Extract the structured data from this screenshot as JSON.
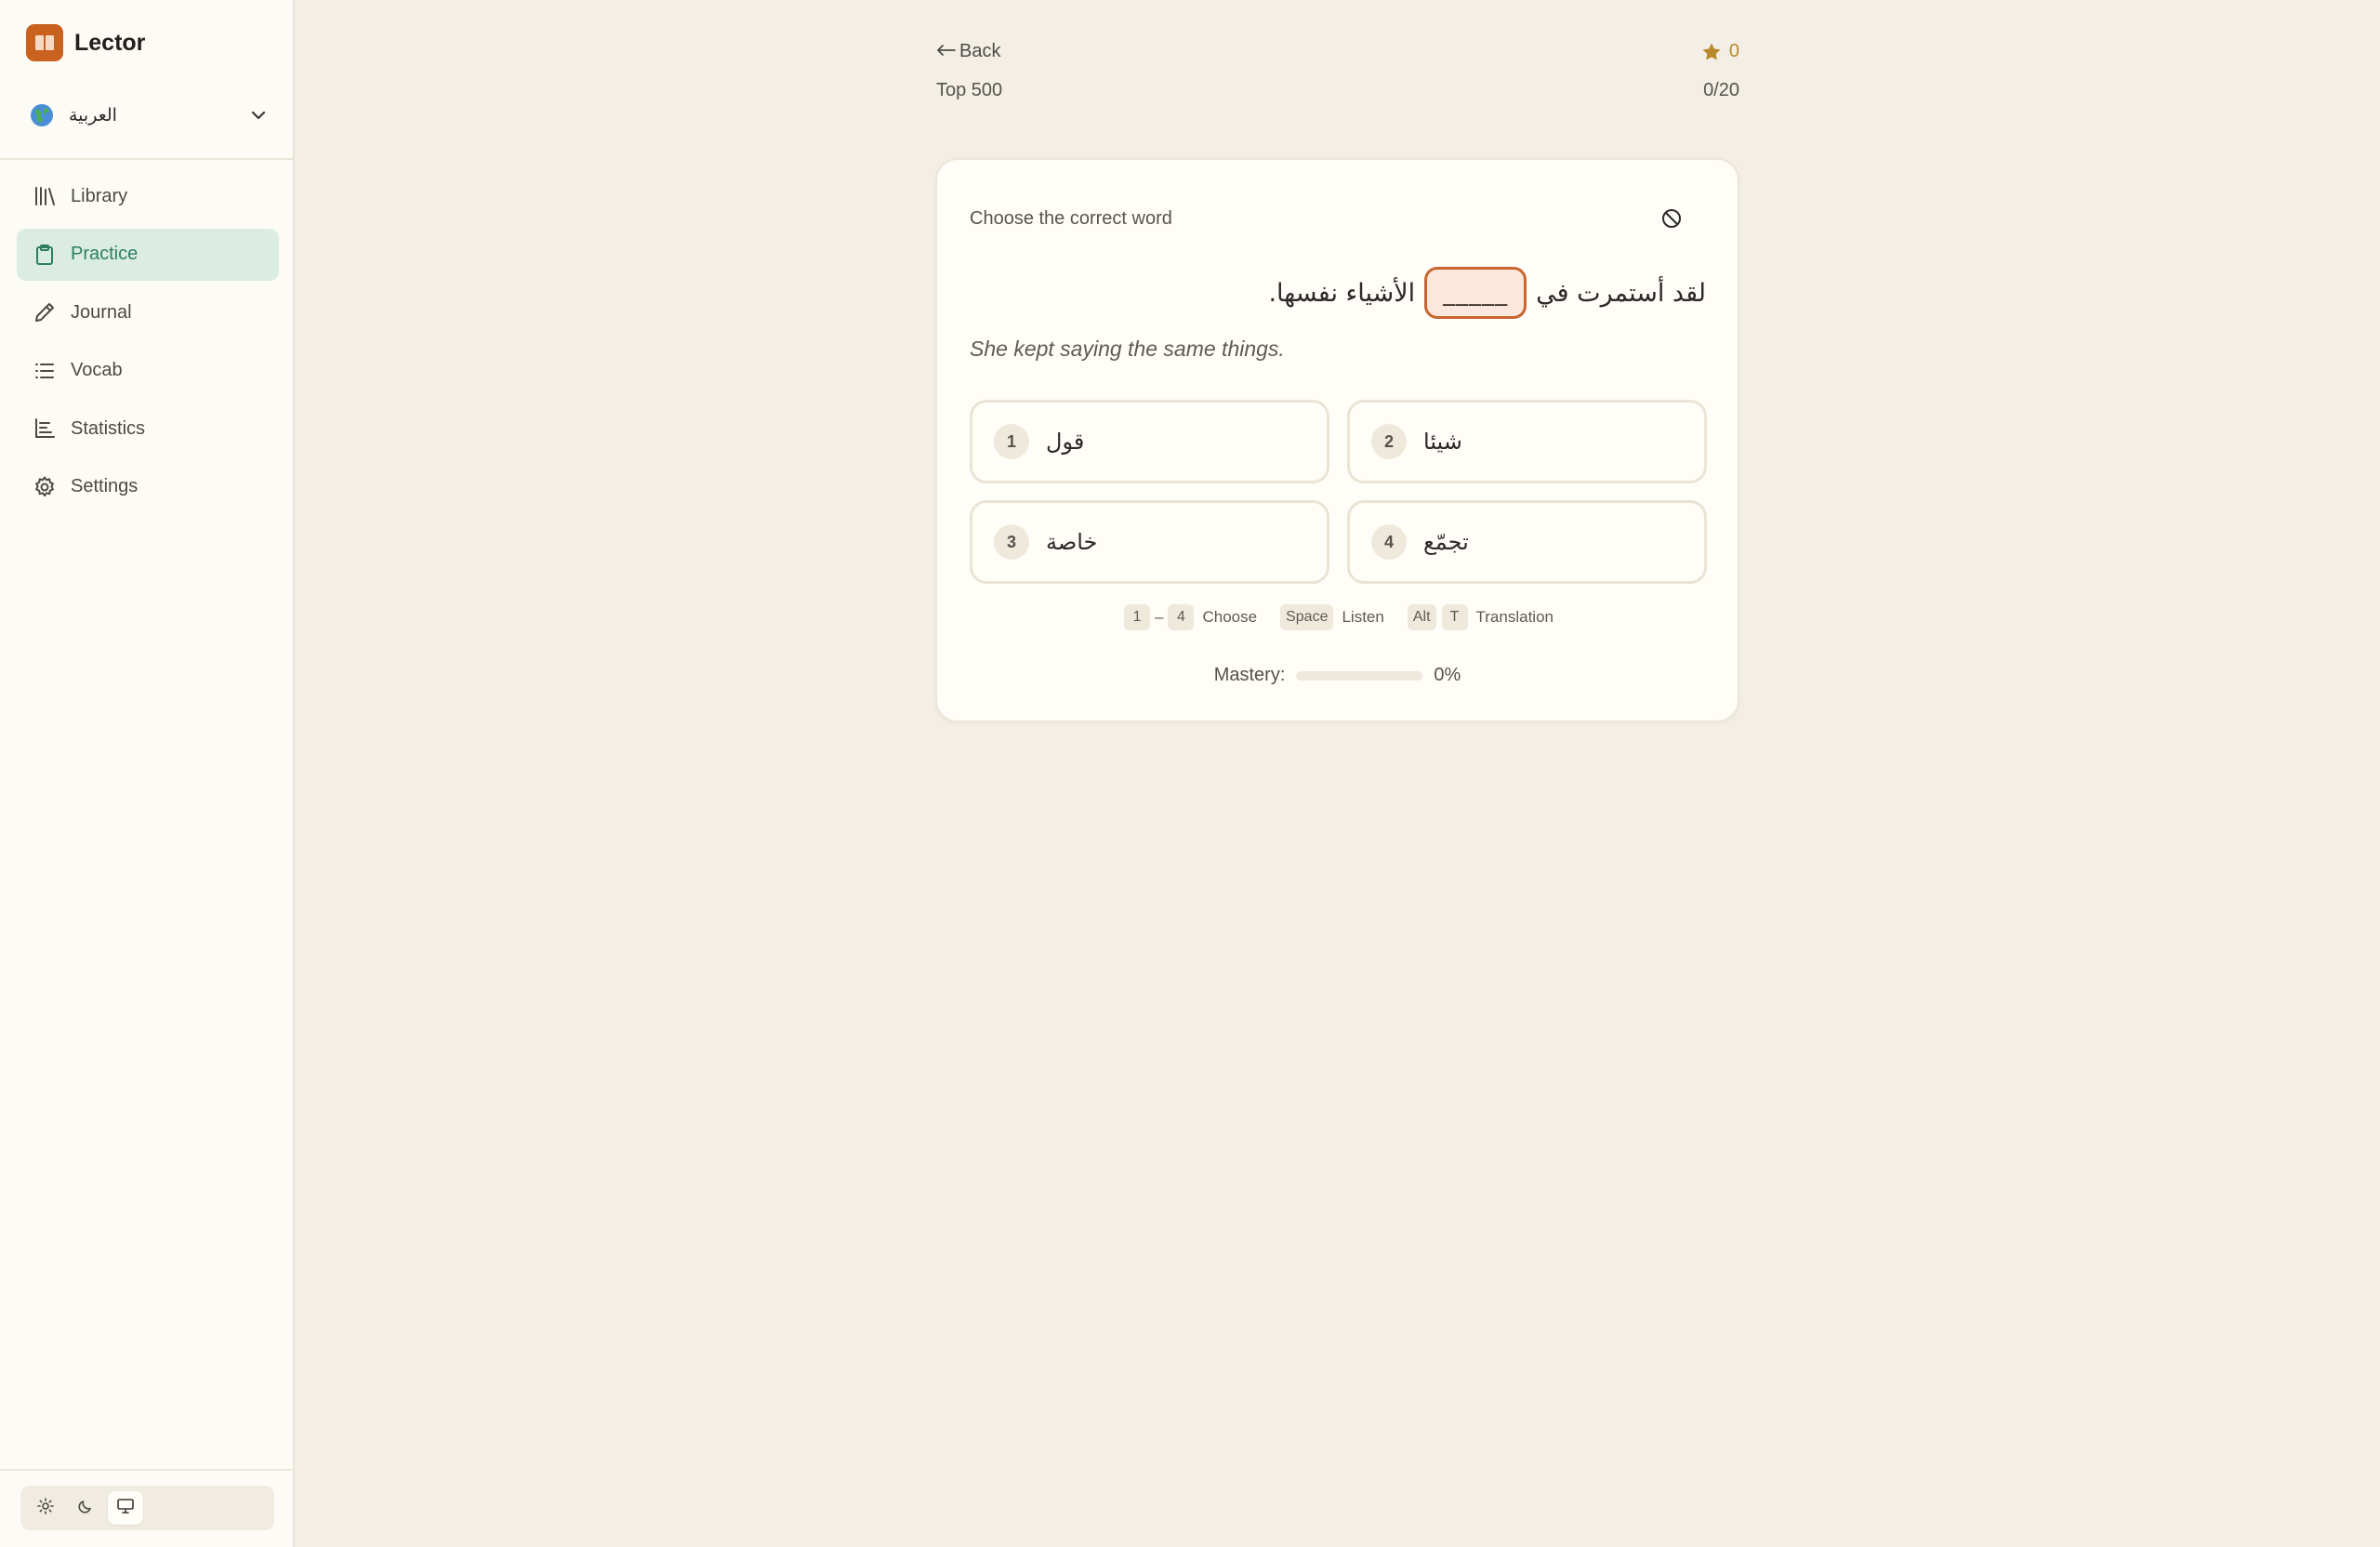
{
  "app": {
    "name": "Lector"
  },
  "language": {
    "name": "العربية",
    "flag_icon": "globe-icon"
  },
  "nav": {
    "items": [
      {
        "label": "Library",
        "icon": "library-icon",
        "active": false
      },
      {
        "label": "Practice",
        "icon": "clipboard-icon",
        "active": true
      },
      {
        "label": "Journal",
        "icon": "pencil-icon",
        "active": false
      },
      {
        "label": "Vocab",
        "icon": "list-icon",
        "active": false
      },
      {
        "label": "Statistics",
        "icon": "bar-chart-icon",
        "active": false
      },
      {
        "label": "Settings",
        "icon": "gear-icon",
        "active": false
      }
    ]
  },
  "theme": {
    "options": [
      "light",
      "dark",
      "system"
    ],
    "selected": "system"
  },
  "header": {
    "back_label": "Back",
    "deck_name": "Top 500",
    "score": "0",
    "progress": "0/20"
  },
  "card": {
    "instruction": "Choose the correct word",
    "sentence_before": "لقد أستمرت في",
    "blank": "_____",
    "sentence_after": "الأشياء نفسها.",
    "translation": "She kept saying the same things.",
    "options": [
      {
        "num": "1",
        "word": "قول"
      },
      {
        "num": "2",
        "word": "شيئا"
      },
      {
        "num": "3",
        "word": "خاصة"
      },
      {
        "num": "4",
        "word": "تجمّع"
      }
    ],
    "shortcuts": {
      "choose_from": "1",
      "choose_dash": "–",
      "choose_to": "4",
      "choose_label": "Choose",
      "listen_key": "Space",
      "listen_label": "Listen",
      "translation_key1": "Alt",
      "translation_key2": "T",
      "translation_label": "Translation"
    },
    "mastery_label": "Mastery:",
    "mastery_value": "0%",
    "mastery_fraction": 0
  },
  "colors": {
    "accent": "#2f7e64",
    "brand": "#c9611f",
    "score": "#b8892a",
    "blank_border": "#c9662f"
  }
}
